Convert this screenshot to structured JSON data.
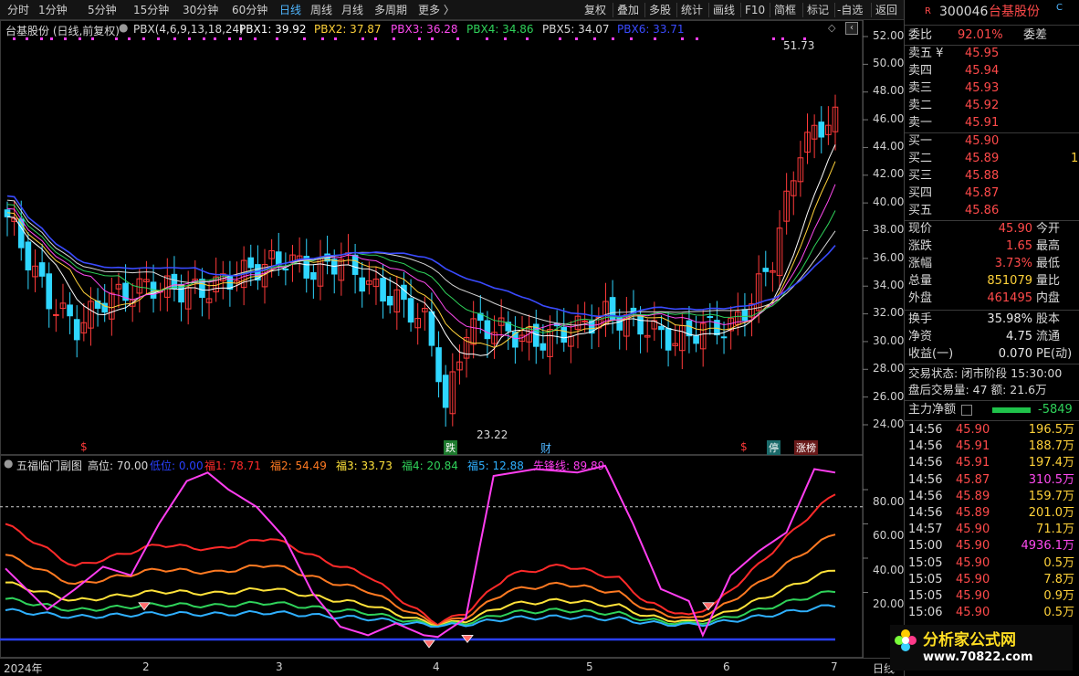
{
  "toolbar": {
    "periods": [
      "分时",
      "1分钟",
      "5分钟",
      "15分钟",
      "30分钟",
      "60分钟",
      "日线",
      "周线",
      "月线",
      "多周期",
      "更多 〉"
    ],
    "active_period": "日线",
    "actions": [
      "复权",
      "叠加",
      "多股",
      "统计",
      "画线",
      "F10",
      "简框",
      "标记",
      "-自选",
      "返回"
    ]
  },
  "stock": {
    "code": "300046",
    "name": "台基股份",
    "r_badge": "R",
    "c_badge": "C"
  },
  "main_legend": {
    "title": "台基股份 (日线,前复权)",
    "indicator": "PBX(4,6,9,13,18,24)",
    "pbx1": "PBX1: 39.92",
    "pbx2": "PBX2: 37.87",
    "pbx3": "PBX3: 36.28",
    "pbx4": "PBX4: 34.86",
    "pbx5": "PBX5: 34.07",
    "pbx6": "PBX6: 33.71",
    "colors": {
      "pbx1": "#ffffff",
      "pbx2": "#ffd23a",
      "pbx3": "#ff4af0",
      "pbx4": "#2fd25a",
      "pbx5": "#d8d8d8",
      "pbx6": "#3a4bff"
    }
  },
  "main_axis": {
    "labels": [
      "52.00",
      "50.00",
      "48.00",
      "46.00",
      "44.00",
      "42.00",
      "40.00",
      "38.00",
      "36.00",
      "34.00",
      "32.00",
      "30.00",
      "28.00",
      "26.00",
      "24.00"
    ],
    "high_note": "51.73",
    "low_note": "23.22"
  },
  "event_markers": {
    "dollar1": "$",
    "die": "跌",
    "cai": "财",
    "dollar2": "$",
    "ting": "停",
    "zhangbang": "涨榜"
  },
  "sub_legend": {
    "title": "五福临门副图",
    "gaowei": "高位: 70.00",
    "diwei": "低位: 0.00",
    "fu1": "福1: 78.71",
    "fu2": "福2: 54.49",
    "fu3": "福3: 33.73",
    "fu4": "福4: 20.84",
    "fu5": "福5: 12.88",
    "xianfeng": "先锋线: 89.89",
    "colors": {
      "fu1": "#ff2a2a",
      "fu2": "#ff7a22",
      "fu3": "#ffe23a",
      "fu4": "#2fd25a",
      "fu5": "#2fb0ff",
      "xianfeng": "#ff3ef0",
      "diwei": "#2a40ff"
    }
  },
  "sub_axis": {
    "labels": [
      "80.00",
      "60.00",
      "40.00",
      "20.00"
    ]
  },
  "x_axis": {
    "labels": [
      "2024年",
      "2",
      "3",
      "4",
      "5",
      "6",
      "7"
    ],
    "right_label": "日线"
  },
  "quote": {
    "weibi_label": "委比",
    "weibi": "92.01%",
    "weicha_label": "委差",
    "sells": [
      {
        "label": "卖五 ¥",
        "price": "45.95"
      },
      {
        "label": "卖四",
        "price": "45.94"
      },
      {
        "label": "卖三",
        "price": "45.93"
      },
      {
        "label": "卖二",
        "price": "45.92"
      },
      {
        "label": "卖一",
        "price": "45.91"
      }
    ],
    "buys": [
      {
        "label": "买一",
        "price": "45.90",
        "vol": ""
      },
      {
        "label": "买二",
        "price": "45.89",
        "vol": "1"
      },
      {
        "label": "买三",
        "price": "45.88",
        "vol": ""
      },
      {
        "label": "买四",
        "price": "45.87",
        "vol": ""
      },
      {
        "label": "买五",
        "price": "45.86",
        "vol": ""
      }
    ],
    "stats": [
      {
        "l1": "现价",
        "v1": "45.90",
        "c1": "red",
        "l2": "今开"
      },
      {
        "l1": "涨跌",
        "v1": "1.65",
        "c1": "red",
        "l2": "最高"
      },
      {
        "l1": "涨幅",
        "v1": "3.73%",
        "c1": "red",
        "l2": "最低"
      },
      {
        "l1": "总量",
        "v1": "851079",
        "c1": "yel",
        "l2": "量比"
      },
      {
        "l1": "外盘",
        "v1": "461495",
        "c1": "red",
        "l2": "内盘"
      }
    ],
    "stats2": [
      {
        "l1": "换手",
        "v1": "35.98%",
        "l2": "股本"
      },
      {
        "l1": "净资",
        "v1": "4.75",
        "l2": "流通"
      },
      {
        "l1": "收益(一)",
        "v1": "0.070",
        "l2": "PE(动)"
      }
    ],
    "trade_status": "交易状态: 闭市阶段 15:30:00",
    "after_hours": "盘后交易量: 47  额: 21.6万",
    "main_net_label": "主力净额",
    "main_net_value": "-5849"
  },
  "ticks": [
    {
      "time": "14:56",
      "price": "45.90",
      "amount": "196.5万",
      "color": "yel"
    },
    {
      "time": "14:56",
      "price": "45.91",
      "amount": "188.7万",
      "color": "yel"
    },
    {
      "time": "14:56",
      "price": "45.91",
      "amount": "197.4万",
      "color": "yel"
    },
    {
      "time": "14:56",
      "price": "45.87",
      "amount": "310.5万",
      "color": "mag"
    },
    {
      "time": "14:56",
      "price": "45.89",
      "amount": "159.7万",
      "color": "yel"
    },
    {
      "time": "14:56",
      "price": "45.89",
      "amount": "201.0万",
      "color": "yel"
    },
    {
      "time": "14:57",
      "price": "45.90",
      "amount": "71.1万",
      "color": "yel"
    },
    {
      "time": "15:00",
      "price": "45.90",
      "amount": "4936.1万",
      "color": "mag"
    },
    {
      "time": "15:05",
      "price": "45.90",
      "amount": "0.5万",
      "color": "yel"
    },
    {
      "time": "15:05",
      "price": "45.90",
      "amount": "7.8万",
      "color": "yel"
    },
    {
      "time": "15:05",
      "price": "45.90",
      "amount": "0.9万",
      "color": "yel"
    },
    {
      "time": "15:06",
      "price": "45.90",
      "amount": "0.5万",
      "color": "yel"
    }
  ],
  "watermark": {
    "brand": "分析家公式网",
    "url": "www.70822.com"
  }
}
